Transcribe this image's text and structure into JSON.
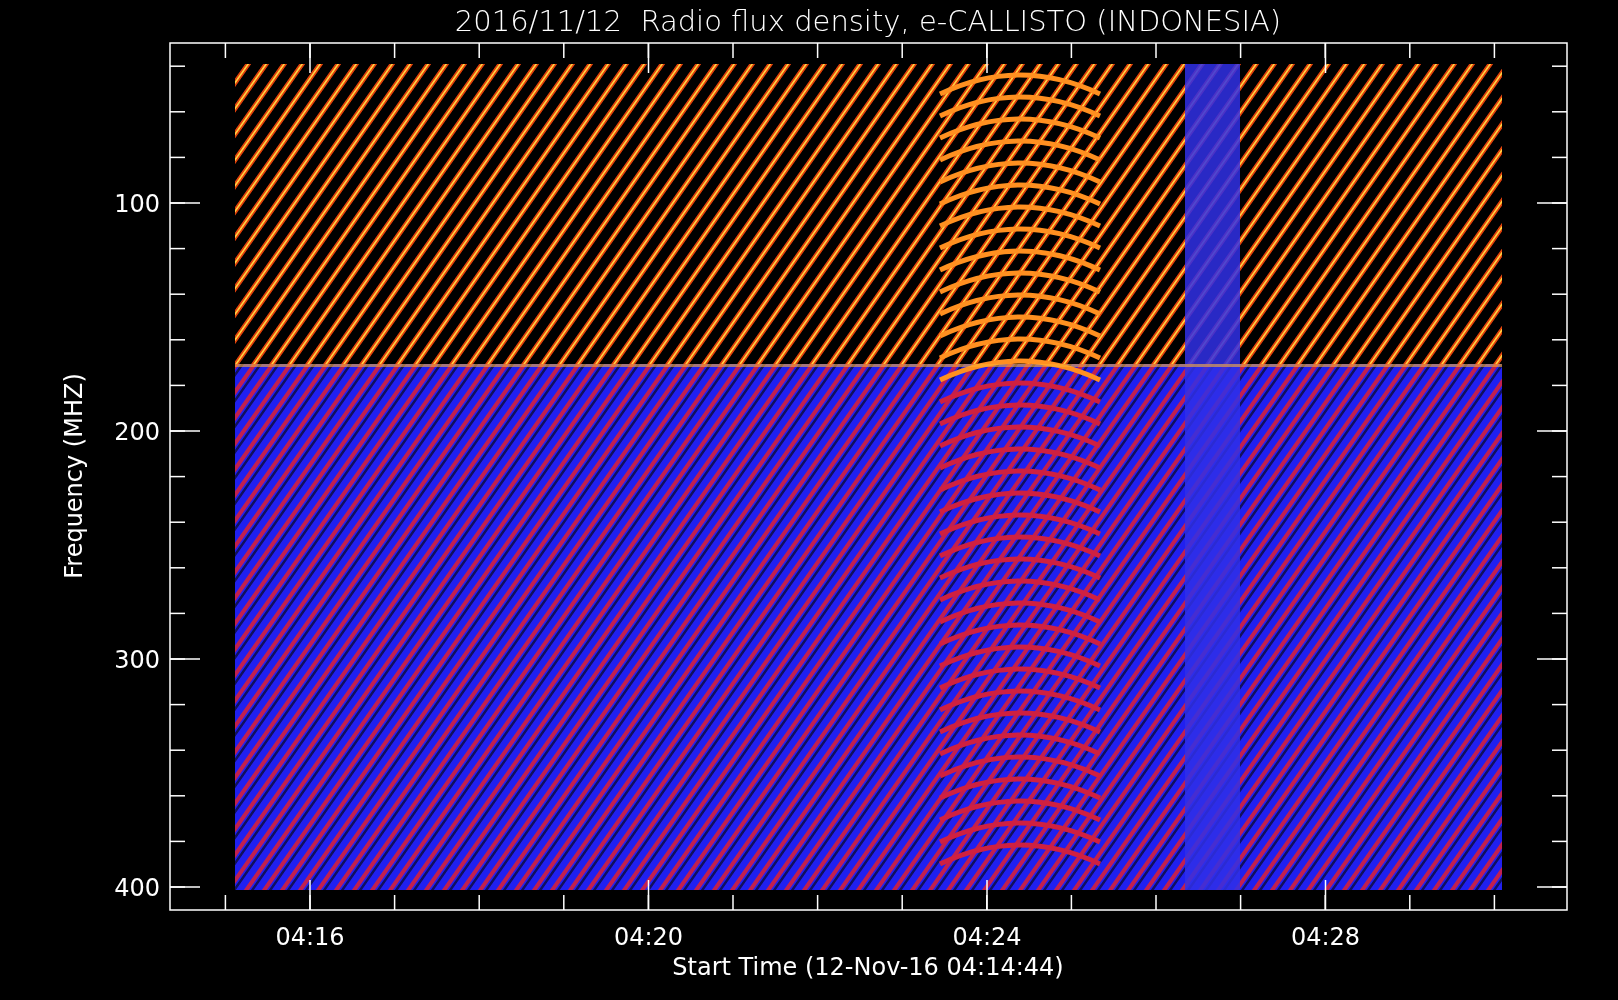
{
  "title": "2016/11/12  Radio flux density, e-CALLISTO (INDONESIA)",
  "y_axis": {
    "label": "Frequency (MHZ)",
    "ticks": [
      "100",
      "200",
      "300",
      "400"
    ]
  },
  "x_axis": {
    "label": "Start Time (12-Nov-16 04:14:44)",
    "ticks": [
      "04:16",
      "04:20",
      "04:24",
      "04:28"
    ]
  }
}
